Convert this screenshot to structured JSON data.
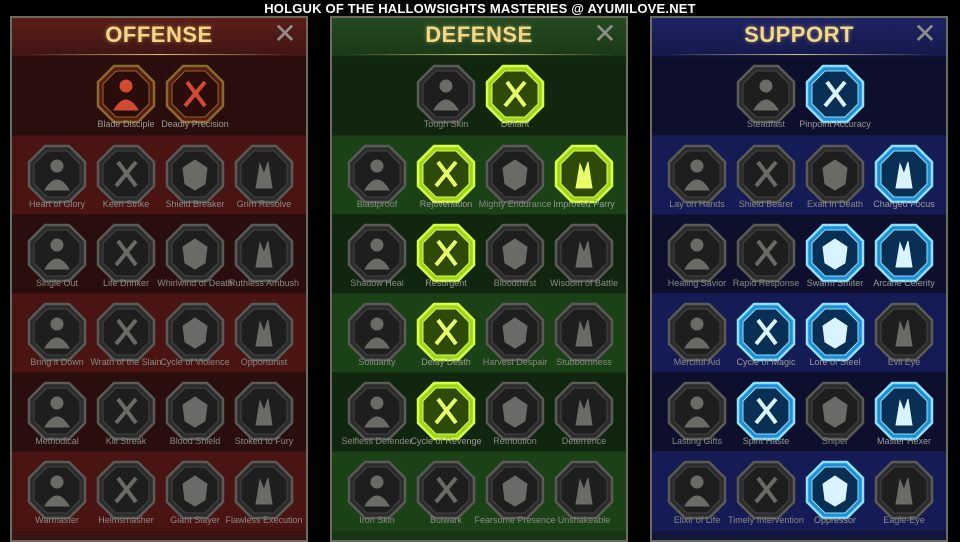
{
  "banner": "HOLGUK OF THE HALLOWSIGHTS MASTERIES @ AYUMILOVE.NET",
  "close_glyph": "✕",
  "colors": {
    "offense_active": "#c0392b",
    "defense_active": "#b9f21c",
    "support_active": "#3db7f0",
    "inactive": "#3a3a3a",
    "title": "#f2d98a"
  },
  "panels": [
    {
      "id": "offense",
      "title": "OFFENSE",
      "rows": [
        [
          {
            "label": "Blade Disciple",
            "active": true,
            "icon": "crossed-swords-icon"
          },
          {
            "label": "Deadly Precision",
            "active": true,
            "icon": "daggers-icon"
          }
        ],
        [
          {
            "label": "Heart of Glory",
            "active": false,
            "icon": "horned-warrior-icon"
          },
          {
            "label": "Keen Strike",
            "active": false,
            "icon": "claw-strike-icon"
          },
          {
            "label": "Shield Breaker",
            "active": false,
            "icon": "broken-shield-icon"
          },
          {
            "label": "Grim Resolve",
            "active": false,
            "icon": "heart-icon"
          }
        ],
        [
          {
            "label": "Single Out",
            "active": false,
            "icon": "punch-icon"
          },
          {
            "label": "Life Drinker",
            "active": false,
            "icon": "fanged-mouth-icon"
          },
          {
            "label": "Whirlwind of Death",
            "active": false,
            "icon": "skull-wind-icon"
          },
          {
            "label": "Ruthless Ambush",
            "active": false,
            "icon": "grabbing-hand-icon"
          }
        ],
        [
          {
            "label": "Bring it Down",
            "active": false,
            "icon": "heart-sword-icon"
          },
          {
            "label": "Wrath of the Slain",
            "active": false,
            "icon": "fist-icon"
          },
          {
            "label": "Cycle of Violence",
            "active": false,
            "icon": "axe-icon"
          },
          {
            "label": "Opportunist",
            "active": false,
            "icon": "chain-lightning-icon"
          }
        ],
        [
          {
            "label": "Methodical",
            "active": false,
            "icon": "spider-icon"
          },
          {
            "label": "Kill Streak",
            "active": false,
            "icon": "skull-icon"
          },
          {
            "label": "Blood Shield",
            "active": false,
            "icon": "sword-shield-icon"
          },
          {
            "label": "Stoked to Fury",
            "active": false,
            "icon": "rage-figure-icon"
          }
        ],
        [
          {
            "label": "Warmaster",
            "active": false,
            "icon": "warmaster-icon"
          },
          {
            "label": "Helmsmasher",
            "active": false,
            "icon": "helmet-icon"
          },
          {
            "label": "Giant Slayer",
            "active": false,
            "icon": "demon-icon"
          },
          {
            "label": "Flawless Execution",
            "active": false,
            "icon": "skull-blade-icon"
          }
        ]
      ]
    },
    {
      "id": "defense",
      "title": "DEFENSE",
      "rows": [
        [
          {
            "label": "Tough Skin",
            "active": false,
            "icon": "scales-icon"
          },
          {
            "label": "Defiant",
            "active": true,
            "icon": "raised-fist-icon"
          }
        ],
        [
          {
            "label": "Blastproof",
            "active": false,
            "icon": "blast-shield-icon"
          },
          {
            "label": "Rejuvenation",
            "active": true,
            "icon": "healing-hand-icon"
          },
          {
            "label": "Mighty Endurance",
            "active": false,
            "icon": "muscle-figure-icon"
          },
          {
            "label": "Improved Parry",
            "active": true,
            "icon": "parry-blades-icon"
          }
        ],
        [
          {
            "label": "Shadow Heal",
            "active": false,
            "icon": "shadow-figure-icon"
          },
          {
            "label": "Resurgent",
            "active": true,
            "icon": "knight-shield-icon"
          },
          {
            "label": "Bloodthirst",
            "active": false,
            "icon": "blood-heart-icon"
          },
          {
            "label": "Wisdom of Battle",
            "active": false,
            "icon": "hooded-face-icon"
          }
        ],
        [
          {
            "label": "Solidarity",
            "active": false,
            "icon": "group-icon"
          },
          {
            "label": "Delay Death",
            "active": true,
            "icon": "hourglass-icon"
          },
          {
            "label": "Harvest Despair",
            "active": false,
            "icon": "open-hand-icon"
          },
          {
            "label": "Stubbornness",
            "active": false,
            "icon": "bull-icon"
          }
        ],
        [
          {
            "label": "Selfless Defender",
            "active": false,
            "icon": "charging-figure-icon"
          },
          {
            "label": "Cycle of Revenge",
            "active": true,
            "icon": "flames-icon"
          },
          {
            "label": "Retribution",
            "active": false,
            "icon": "burning-skull-icon"
          },
          {
            "label": "Deterrence",
            "active": false,
            "icon": "deflect-icon"
          }
        ],
        [
          {
            "label": "Iron Skin",
            "active": false,
            "icon": "armored-figure-icon"
          },
          {
            "label": "Bulwark",
            "active": false,
            "icon": "tower-shield-icon"
          },
          {
            "label": "Fearsome Presence",
            "active": false,
            "icon": "screaming-face-icon"
          },
          {
            "label": "Unshakeable",
            "active": false,
            "icon": "strongman-icon"
          }
        ]
      ]
    },
    {
      "id": "support",
      "title": "SUPPORT",
      "rows": [
        [
          {
            "label": "Steadfast",
            "active": false,
            "icon": "heart-sparkle-icon"
          },
          {
            "label": "Pinpoint Accuracy",
            "active": true,
            "icon": "target-icon"
          }
        ],
        [
          {
            "label": "Lay on Hands",
            "active": false,
            "icon": "praying-hands-icon"
          },
          {
            "label": "Shield Bearer",
            "active": false,
            "icon": "shield-rings-icon"
          },
          {
            "label": "Exalt in Death",
            "active": false,
            "icon": "smoking-skull-icon"
          },
          {
            "label": "Charged Focus",
            "active": true,
            "icon": "energy-hand-icon"
          }
        ],
        [
          {
            "label": "Healing Savior",
            "active": false,
            "icon": "glowing-figure-icon"
          },
          {
            "label": "Rapid Response",
            "active": false,
            "icon": "lightning-icon"
          },
          {
            "label": "Swarm Smiter",
            "active": true,
            "icon": "swarm-bolt-icon"
          },
          {
            "label": "Arcane Celerity",
            "active": true,
            "icon": "speed-figures-icon"
          }
        ],
        [
          {
            "label": "Merciful Aid",
            "active": false,
            "icon": "chained-heart-icon"
          },
          {
            "label": "Cycle of Magic",
            "active": true,
            "icon": "comet-icon"
          },
          {
            "label": "Lore of Steel",
            "active": true,
            "icon": "open-book-icon"
          },
          {
            "label": "Evil Eye",
            "active": false,
            "icon": "feather-eye-icon"
          }
        ],
        [
          {
            "label": "Lasting Gifts",
            "active": false,
            "icon": "compass-star-icon"
          },
          {
            "label": "Spirit Haste",
            "active": true,
            "icon": "winged-boot-icon"
          },
          {
            "label": "Sniper",
            "active": false,
            "icon": "eye-icon"
          },
          {
            "label": "Master Hexer",
            "active": true,
            "icon": "hex-figure-icon"
          }
        ],
        [
          {
            "label": "Elixir of Life",
            "active": false,
            "icon": "potion-icon"
          },
          {
            "label": "Timely Intervention",
            "active": false,
            "icon": "grim-skull-icon"
          },
          {
            "label": "Oppressor",
            "active": true,
            "icon": "crushing-fist-icon"
          },
          {
            "label": "Eagle-Eye",
            "active": false,
            "icon": "eagle-icon"
          }
        ]
      ]
    }
  ]
}
